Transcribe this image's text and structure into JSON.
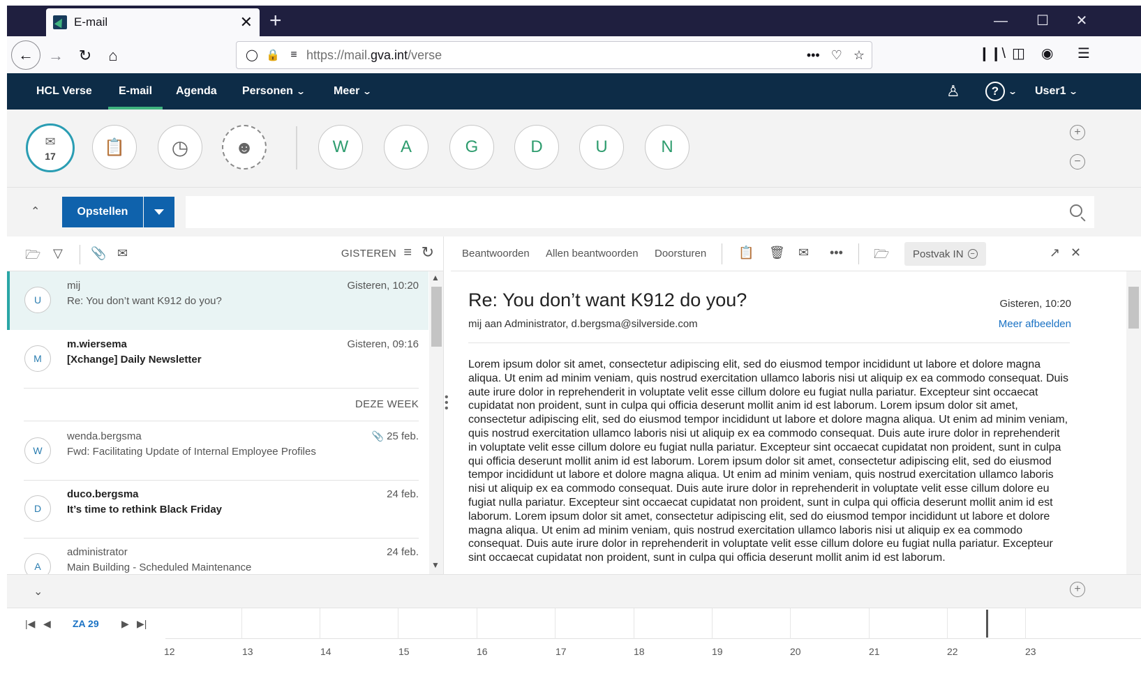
{
  "browser": {
    "tab_title": "E-mail",
    "tab_close": "✕",
    "new_tab": "+",
    "url_prefix": "https://mail.",
    "url_domain": "gva.int",
    "url_path": "/verse"
  },
  "app": {
    "menu": [
      {
        "label": "HCL Verse"
      },
      {
        "label": "E-mail"
      },
      {
        "label": "Agenda"
      },
      {
        "label": "Personen"
      },
      {
        "label": "Meer"
      }
    ],
    "user": "User1"
  },
  "bubbles": {
    "inbox_count": "17",
    "people": [
      "W",
      "A",
      "G",
      "D",
      "U",
      "N"
    ]
  },
  "compose": {
    "label": "Opstellen",
    "search_placeholder": ""
  },
  "list": {
    "date_group": "GISTEREN",
    "section_this_week": "DEZE WEEK",
    "messages": [
      {
        "initial": "U",
        "sender": "mij",
        "subject": "Re: You don’t want K912 do you?",
        "time": "Gisteren, 10:20"
      },
      {
        "initial": "M",
        "sender": "m.wiersema",
        "subject": "[Xchange] Daily Newsletter",
        "time": "Gisteren, 09:16"
      },
      {
        "initial": "W",
        "sender": "wenda.bergsma",
        "subject": "Fwd: Facilitating Update of Internal Employee Profiles",
        "time": "25 feb."
      },
      {
        "initial": "D",
        "sender": "duco.bergsma",
        "subject": "It’s time to rethink Black Friday",
        "time": "24 feb."
      },
      {
        "initial": "A",
        "sender": "administrator",
        "subject": "Main Building - Scheduled Maintenance",
        "time": "24 feb."
      }
    ]
  },
  "reader": {
    "actions": {
      "reply": "Beantwoorden",
      "reply_all": "Allen beantwoorden",
      "forward": "Doorsturen"
    },
    "folder": "Postvak IN",
    "subject": "Re: You don’t want K912 do you?",
    "recipients": "mij aan Administrator, d.bergsma@silverside.com",
    "date": "Gisteren, 10:20",
    "show_images": "Meer afbeelden",
    "body": "Lorem ipsum dolor sit amet, consectetur adipiscing elit, sed do eiusmod tempor incididunt ut labore et dolore magna aliqua. Ut enim ad minim veniam, quis nostrud exercitation ullamco laboris nisi ut aliquip ex ea commodo consequat. Duis aute irure dolor in reprehenderit in voluptate velit esse cillum dolore eu fugiat nulla pariatur. Excepteur sint occaecat cupidatat non proident, sunt in culpa qui officia deserunt mollit anim id est laborum. Lorem ipsum dolor sit amet, consectetur adipiscing elit, sed do eiusmod tempor incididunt ut labore et dolore magna aliqua. Ut enim ad minim veniam, quis nostrud exercitation ullamco laboris nisi ut aliquip ex ea commodo consequat. Duis aute irure dolor in reprehenderit in voluptate velit esse cillum dolore eu fugiat nulla pariatur. Excepteur sint occaecat cupidatat non proident, sunt in culpa qui officia deserunt mollit anim id est laborum. Lorem ipsum dolor sit amet, consectetur adipiscing elit, sed do eiusmod tempor incididunt ut labore et dolore magna aliqua. Ut enim ad minim veniam, quis nostrud exercitation ullamco laboris nisi ut aliquip ex ea commodo consequat. Duis aute irure dolor in reprehenderit in voluptate velit esse cillum dolore eu fugiat nulla pariatur. Excepteur sint occaecat cupidatat non proident, sunt in culpa qui officia deserunt mollit anim id est laborum. Lorem ipsum dolor sit amet, consectetur adipiscing elit, sed do eiusmod tempor incididunt ut labore et dolore magna aliqua. Ut enim ad minim veniam, quis nostrud exercitation ullamco laboris nisi ut aliquip ex ea commodo consequat. Duis aute irure dolor in reprehenderit in voluptate velit esse cillum dolore eu fugiat nulla pariatur. Excepteur sint occaecat cupidatat non proident, sunt in culpa qui officia deserunt mollit anim id est laborum."
  },
  "calendar": {
    "day": "ZA 29",
    "hours": [
      "12",
      "13",
      "14",
      "15",
      "16",
      "17",
      "18",
      "19",
      "20",
      "21",
      "22",
      "23"
    ]
  },
  "colors": {
    "brand_navy": "#0d2c47",
    "accent_green": "#3fb27f",
    "compose_blue": "#0f62ac",
    "selected_teal": "#2aa6a6",
    "link_blue": "#1a72c4"
  },
  "icons": [
    "back-icon",
    "forward-icon",
    "reload-icon",
    "home-icon",
    "shield-icon",
    "lock-icon",
    "permissions-icon",
    "more-icon",
    "pocket-icon",
    "bookmark-star-icon",
    "library-icon",
    "sidebar-icon",
    "account-icon",
    "hamburger-menu-icon",
    "accessibility-icon",
    "help-icon",
    "inbox-icon",
    "tasks-icon",
    "clock-icon",
    "person-icon",
    "zoom-in-icon",
    "zoom-out-icon",
    "search-icon",
    "folder-icon",
    "filter-icon",
    "attachment-icon",
    "envelope-icon",
    "sort-icon",
    "refresh-icon",
    "clipboard-icon",
    "trash-icon",
    "open-envelope-icon",
    "move-folder-icon",
    "popout-icon",
    "close-icon"
  ]
}
